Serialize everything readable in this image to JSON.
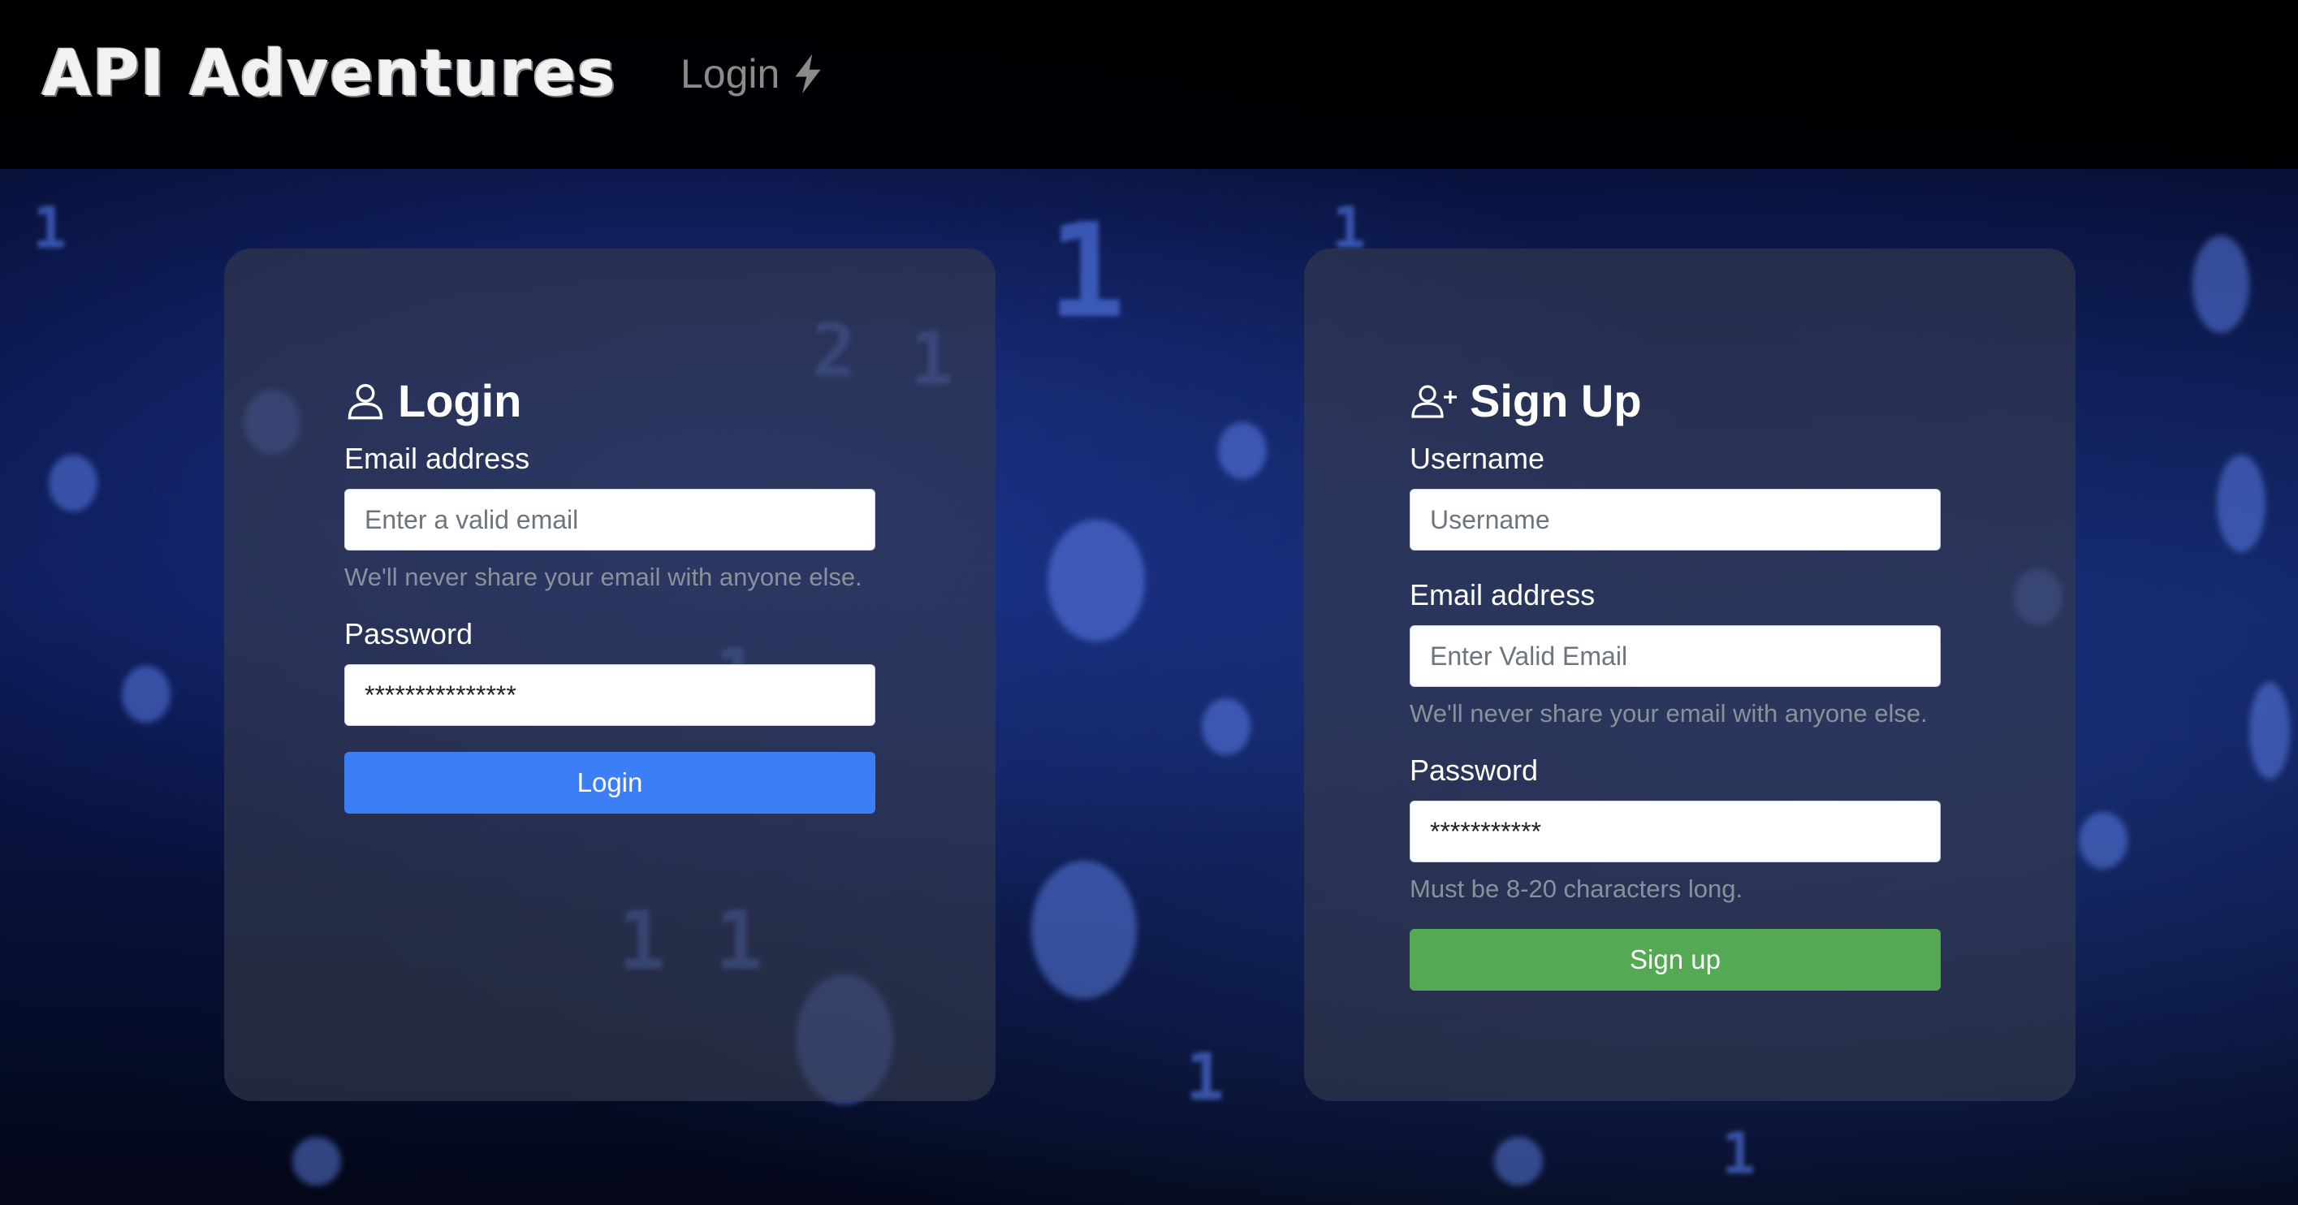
{
  "header": {
    "brand": "API Adventures",
    "nav_login": "Login"
  },
  "login": {
    "title": "Login",
    "email_label": "Email address",
    "email_placeholder": "Enter a valid email",
    "email_help": "We'll never share your email with anyone else.",
    "password_label": "Password",
    "password_value": "***************",
    "button_label": "Login"
  },
  "signup": {
    "title": "Sign Up",
    "username_label": "Username",
    "username_placeholder": "Username",
    "email_label": "Email address",
    "email_placeholder": "Enter Valid Email",
    "email_help": "We'll never share your email with anyone else.",
    "password_label": "Password",
    "password_value": "***********",
    "password_help": "Must be 8-20 characters long.",
    "button_label": "Sign up"
  },
  "colors": {
    "login_button": "#3b7ef6",
    "signup_button": "#55a854"
  }
}
